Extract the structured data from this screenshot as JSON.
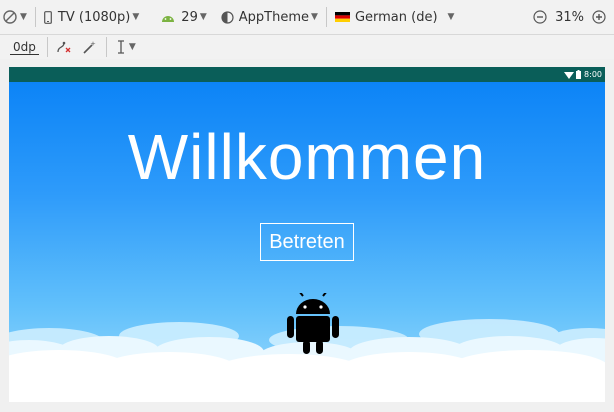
{
  "toolbar": {
    "device_label": "TV (1080p)",
    "api_level": "29",
    "theme_label": "AppTheme",
    "locale_label": "German (de)",
    "zoom_label": "31%",
    "margin_label": "0dp"
  },
  "device": {
    "status_time": "8:00",
    "title": "Willkommen",
    "enter_button_label": "Betreten"
  },
  "colors": {
    "status_bar": "#0a5e59",
    "sky_top": "#0c84f7",
    "sky_bottom": "#9fdcfc",
    "android_green": "#3ddc84"
  }
}
